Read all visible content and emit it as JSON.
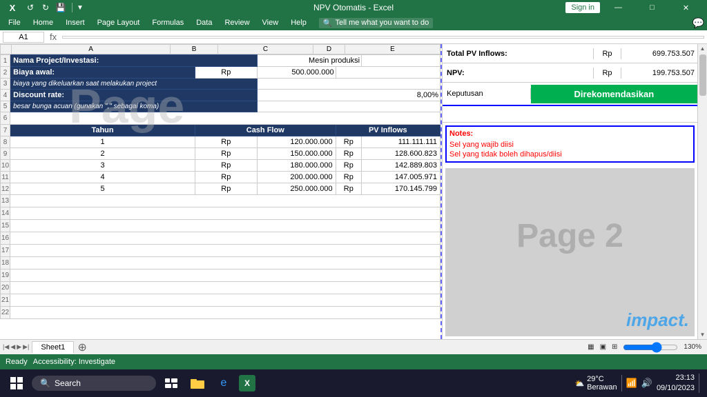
{
  "titlebar": {
    "app_title": "NPV Otomatis - Excel",
    "sign_in": "Sign in",
    "undo_icon": "↩",
    "redo_icon": "↪"
  },
  "ribbon": {
    "tabs": [
      "File",
      "Home",
      "Insert",
      "Page Layout",
      "Formulas",
      "Data",
      "Review",
      "View",
      "Help"
    ],
    "search_placeholder": "Tell me what you want to do"
  },
  "spreadsheet": {
    "project_label": "Nama Project/Investasi:",
    "project_value": "Mesin produksi",
    "biaya_label": "Biaya awal:",
    "biaya_sub": "biaya yang dikeluarkan saat melakukan project",
    "biaya_rp": "Rp",
    "biaya_value": "500.000.000",
    "discount_label": "Discount rate:",
    "discount_sub": "besar bunga acuan (gunakan \",\" sebagai koma)",
    "discount_value": "8,00%",
    "table_headers": [
      "Tahun",
      "Cash Flow",
      "PV Inflows"
    ],
    "rows": [
      {
        "tahun": "1",
        "rp1": "Rp",
        "cashflow": "120.000.000",
        "rp2": "Rp",
        "pv": "111.111.111"
      },
      {
        "tahun": "2",
        "rp1": "Rp",
        "cashflow": "150.000.000",
        "rp2": "Rp",
        "pv": "128.600.823"
      },
      {
        "tahun": "3",
        "rp1": "Rp",
        "cashflow": "180.000.000",
        "rp2": "Rp",
        "pv": "142.889.803"
      },
      {
        "tahun": "4",
        "rp1": "Rp",
        "cashflow": "200.000.000",
        "rp2": "Rp",
        "pv": "147.005.971"
      },
      {
        "tahun": "5",
        "rp1": "Rp",
        "cashflow": "250.000.000",
        "rp2": "Rp",
        "pv": "170.145.799"
      }
    ]
  },
  "right_panel": {
    "total_pv_label": "Total PV Inflows:",
    "total_pv_rp": "Rp",
    "total_pv_value": "699.753.507",
    "npv_label": "NPV:",
    "npv_rp": "Rp",
    "npv_value": "199.753.507",
    "keputusan_label": "Keputusan",
    "keputusan_value": "Direkomendasikan",
    "notes_label": "Notes:",
    "note1": "Sel yang wajib diisi",
    "note2": "Sel yang tidak boleh dihapus/diisi",
    "page2_watermark": "Page 2",
    "impact": "impact."
  },
  "sheet_tabs": {
    "sheets": [
      "Sheet1"
    ],
    "active": "Sheet1"
  },
  "status_bar": {
    "ready": "Ready",
    "accessibility": "Accessibility: Investigate",
    "zoom": "130%"
  },
  "taskbar": {
    "search_placeholder": "Search",
    "time": "23:13",
    "date": "09/10/2023",
    "weather": "29°C",
    "weather_sub": "Berawan"
  },
  "watermarks": {
    "page1": "Page",
    "page2": "Page 2"
  }
}
